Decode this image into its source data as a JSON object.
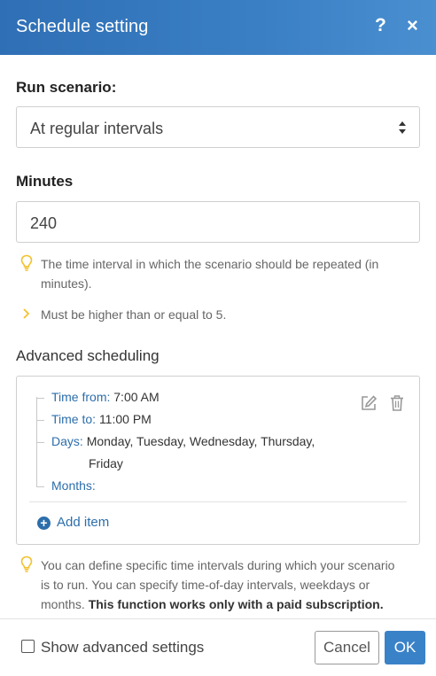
{
  "dialog": {
    "title": "Schedule setting",
    "help_glyph": "?",
    "close_glyph": "×"
  },
  "run_scenario": {
    "label": "Run scenario:",
    "selected": "At regular intervals"
  },
  "minutes": {
    "label": "Minutes",
    "value": "240",
    "hint": "The time interval in which the scenario should be repeated (in minutes).",
    "validation": "Must be higher than or equal to 5."
  },
  "advanced": {
    "title": "Advanced scheduling",
    "item": {
      "time_from_label": "Time from:",
      "time_from_value": "7:00 AM",
      "time_to_label": "Time to:",
      "time_to_value": "11:00 PM",
      "days_label": "Days:",
      "days_value_line1": "Monday, Tuesday, Wednesday, Thursday,",
      "days_value_line2": "Friday",
      "months_label": "Months:",
      "months_value": ""
    },
    "add_item_label": "Add item",
    "info_line1": "You can define specific time intervals during which your scenario",
    "info_line2": "is to run. You can specify time-of-day intervals, weekdays or",
    "info_line3_prefix": "months.",
    "info_line3_bold": "This function works only with a paid subscription."
  },
  "footer": {
    "show_advanced_label": "Show advanced settings",
    "show_advanced_checked": false,
    "cancel_label": "Cancel",
    "ok_label": "OK"
  },
  "colors": {
    "header_blue": "#2f6fb5",
    "link_blue": "#2c6eab",
    "ok_blue": "#3a82c8",
    "hint_yellow": "#f2c12e"
  }
}
